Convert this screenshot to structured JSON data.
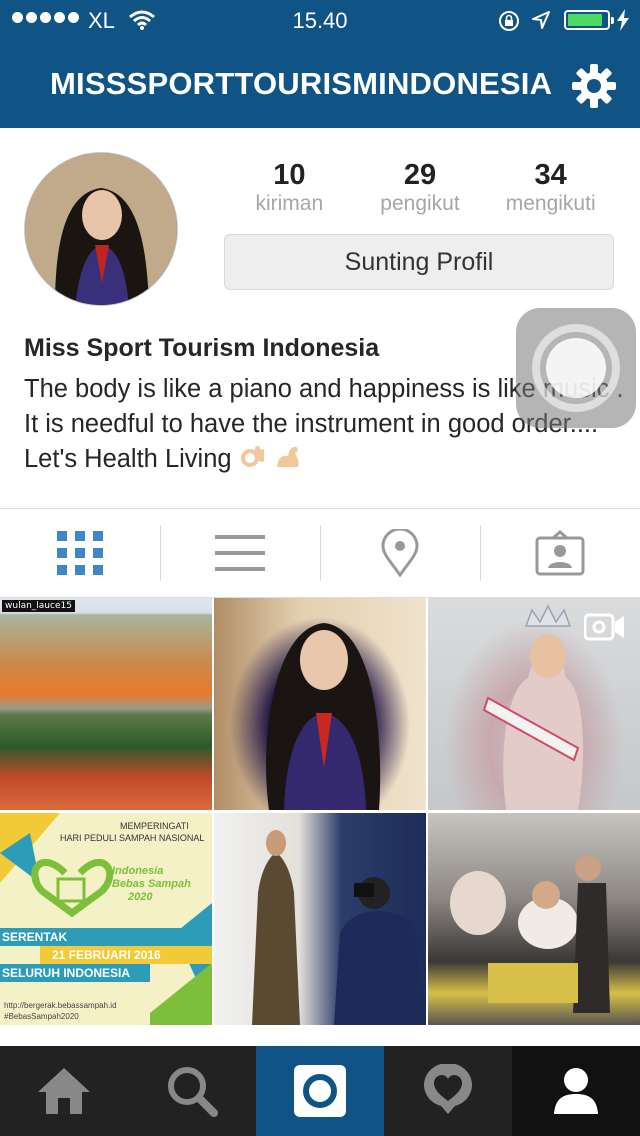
{
  "status_bar": {
    "carrier": "XL",
    "time": "15.40",
    "battery_level": 0.8
  },
  "nav": {
    "title": "MISSSPORTTOURISMINDONESIA",
    "settings_icon": "gear-icon"
  },
  "profile": {
    "posts_count": "10",
    "posts_label": "kiriman",
    "followers_count": "29",
    "followers_label": "pengikut",
    "following_count": "34",
    "following_label": "mengikuti",
    "edit_button": "Sunting Profil",
    "name": "Miss Sport Tourism Indonesia",
    "bio": "The body is like a piano and happiness is like music . It is needful to have the instrument in good order.... Let's Health Living",
    "bio_emojis": [
      "ok-hand-icon",
      "flexed-biceps-icon"
    ]
  },
  "view_tabs": [
    {
      "icon": "grid-icon",
      "active": true
    },
    {
      "icon": "list-icon",
      "active": false
    },
    {
      "icon": "location-pin-icon",
      "active": false
    },
    {
      "icon": "tagged-photos-icon",
      "active": false
    }
  ],
  "grid": {
    "tile1_badge": "wulan_lauce15",
    "poster": {
      "line1": "MEMPERINGATI",
      "line2": "HARI PEDULI SAMPAH NASIONAL",
      "line3": "Indonesia",
      "line4": "Bebas Sampah",
      "line5": "2020",
      "line6": "SERENTAK",
      "line7": "21 FEBRUARI 2016",
      "line8": "SELURUH INDONESIA",
      "line9": "http://bergerak.bebassampah.id",
      "line10": "#BebasSampah2020"
    }
  },
  "tab_bar": [
    {
      "icon": "home-icon",
      "active": false
    },
    {
      "icon": "search-icon",
      "active": false
    },
    {
      "icon": "camera-icon",
      "active": true
    },
    {
      "icon": "activity-heart-icon",
      "active": false
    },
    {
      "icon": "profile-icon",
      "active": false
    }
  ],
  "colors": {
    "brand_blue": "#0f5485",
    "accent_blue": "#3f86c8",
    "battery_green": "#4cd964"
  }
}
